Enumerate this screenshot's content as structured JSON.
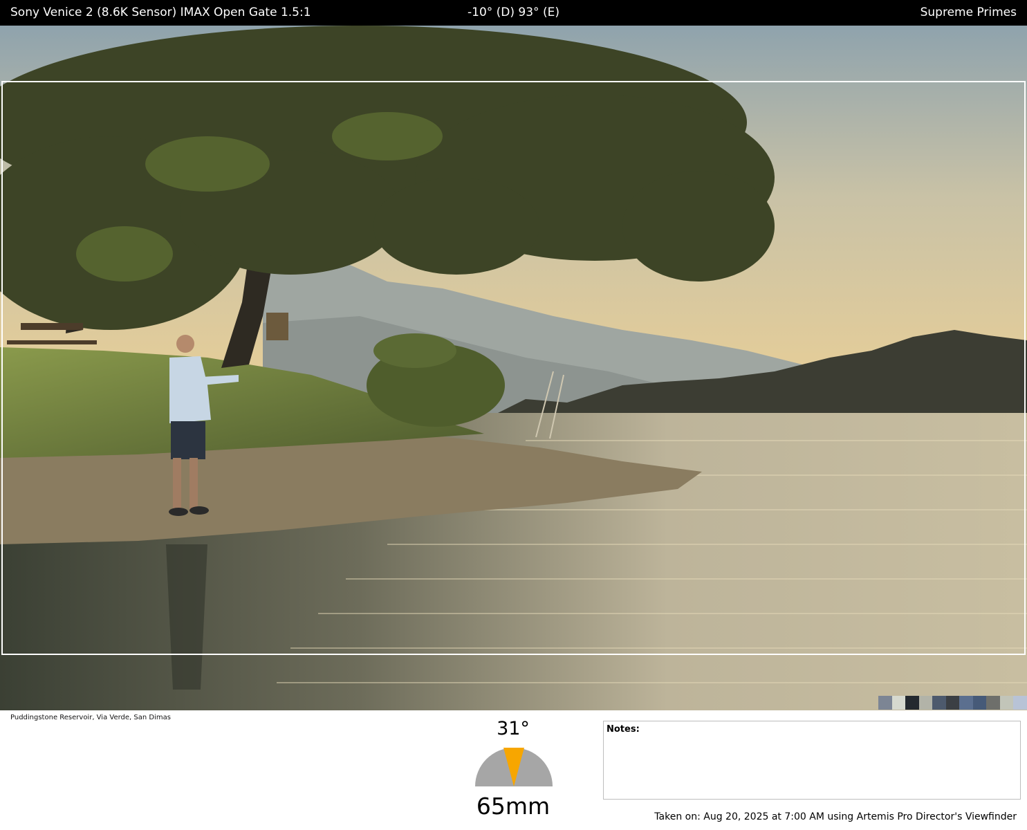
{
  "header": {
    "camera": "Sony Venice 2 (8.6K Sensor) IMAX Open Gate 1.5:1",
    "orientation": "-10° (D) 93° (E)",
    "lens_set": "Supreme Primes"
  },
  "photo": {
    "location": "Puddingstone Reservoir, Via Verde, San Dimas",
    "palette": [
      "#7c8594",
      "#d6d9cf",
      "#24292f",
      "#b2b3a8",
      "#4d5a6d",
      "#3b3f44",
      "#5b6f8f",
      "#465a78",
      "#6e6f6b",
      "#c2c5b9",
      "#b8c3d6"
    ]
  },
  "lens_info": {
    "field_of_view": "31°",
    "focal_length": "65mm",
    "indicator_color": "#f7a600"
  },
  "notes": {
    "label": "Notes:"
  },
  "footer": {
    "taken_on": "Taken on: Aug 20, 2025 at 7:00 AM using Artemis Pro Director's Viewfinder"
  }
}
